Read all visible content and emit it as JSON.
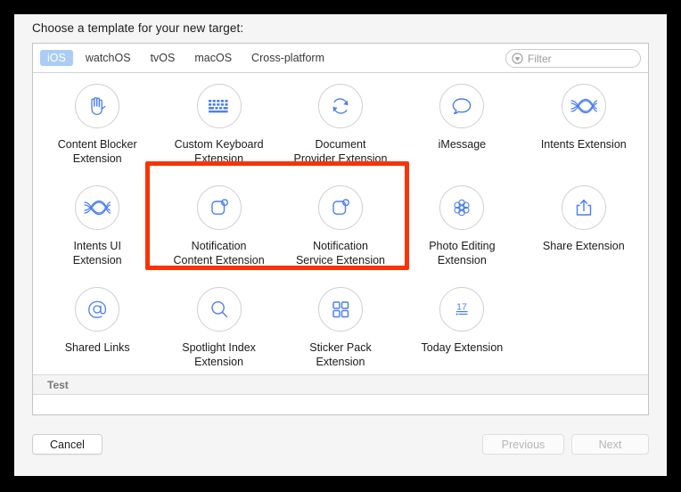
{
  "dialog": {
    "prompt": "Choose a template for your new target:"
  },
  "tabs": [
    {
      "label": "iOS",
      "active": true
    },
    {
      "label": "watchOS",
      "active": false
    },
    {
      "label": "tvOS",
      "active": false
    },
    {
      "label": "macOS",
      "active": false
    },
    {
      "label": "Cross-platform",
      "active": false
    }
  ],
  "filter": {
    "placeholder": "Filter",
    "value": "",
    "icon": "filter-icon"
  },
  "templates": [
    {
      "label": "Content Blocker\nExtension",
      "icon": "hand-icon",
      "highlighted": false
    },
    {
      "label": "Custom Keyboard\nExtension",
      "icon": "keyboard-icon",
      "highlighted": false
    },
    {
      "label": "Document\nProvider Extension",
      "icon": "refresh-circular-icon",
      "highlighted": false
    },
    {
      "label": "iMessage",
      "icon": "speech-bubble-icon",
      "highlighted": false
    },
    {
      "label": "Intents Extension",
      "icon": "intents-weave-icon",
      "highlighted": false
    },
    {
      "label": "Intents UI\nExtension",
      "icon": "intents-weave-icon",
      "highlighted": false
    },
    {
      "label": "Notification\nContent Extension",
      "icon": "notification-badge-icon",
      "highlighted": true
    },
    {
      "label": "Notification\nService Extension",
      "icon": "notification-badge-icon",
      "highlighted": true
    },
    {
      "label": "Photo Editing\nExtension",
      "icon": "flower-petals-icon",
      "highlighted": false
    },
    {
      "label": "Share Extension",
      "icon": "share-upload-icon",
      "highlighted": false
    },
    {
      "label": "Shared Links",
      "icon": "at-sign-icon",
      "highlighted": false
    },
    {
      "label": "Spotlight Index\nExtension",
      "icon": "magnifier-icon",
      "highlighted": false
    },
    {
      "label": "Sticker Pack\nExtension",
      "icon": "grid-squares-icon",
      "highlighted": false
    },
    {
      "label": "Today Extension",
      "icon": "today-calendar-17-icon",
      "highlighted": false
    }
  ],
  "section_header": {
    "label": "Test"
  },
  "footer": {
    "cancel_label": "Cancel",
    "previous_label": "Previous",
    "next_label": "Next",
    "previous_enabled": false,
    "next_enabled": false
  },
  "colors": {
    "accent_blue": "#4a7ff0",
    "tab_active_bg": "#aacdf5",
    "annotation_red": "#fb3206",
    "icon_ring": "#cfcfcf"
  }
}
